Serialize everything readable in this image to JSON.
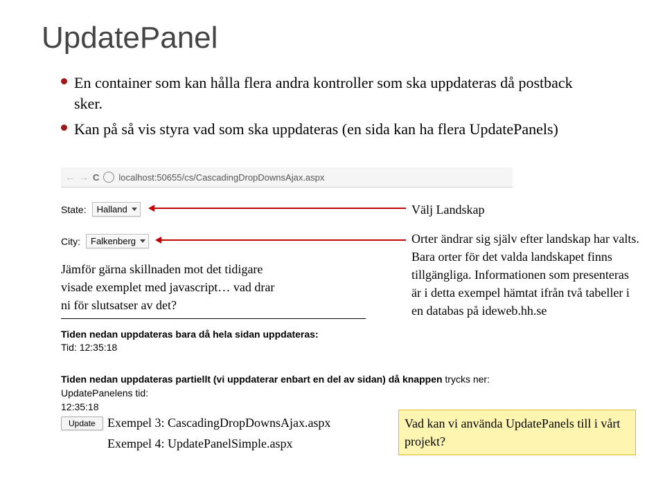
{
  "title": "UpdatePanel",
  "bullet1": "En container som kan hålla flera andra kontroller som ska uppdateras då postback sker.",
  "bullet2": "Kan på så vis styra vad som ska uppdateras (en sida kan ha flera UpdatePanels)",
  "url": "localhost:50655/cs/CascadingDropDownsAjax.aspx",
  "stateLabel": "State:",
  "stateValue": "Halland",
  "cityLabel": "City:",
  "cityValue": "Falkenberg",
  "leftNote": "Jämför gärna skillnaden mot det tidigare visade exemplet med javascript… vad drar ni för slutsatser av det?",
  "rightHeading": "Välj Landskap",
  "rightNote": "Orter ändrar sig själv efter landskap har valts. Bara orter för det valda landskapet finns tillgängliga. Informationen som presenteras är i detta exempel hämtat ifrån två tabeller i en databas på ideweb.hh.se",
  "tidenLine1": "Tiden nedan uppdateras bara då hela sidan uppdateras:",
  "tidLabel": "Tid: 12:35:18",
  "tidenLine2a": "Tiden nedan uppdateras partiellt (vi uppdaterar enbart en del av sidan) då knappen",
  "tidenLine2b": " trycks ner:",
  "updatePanelensTid": "UpdatePanelens tid:",
  "time2": "12:35:18",
  "updateBtn": "Update",
  "exempel3": "Exempel 3: CascadingDropDownsAjax.aspx",
  "exempel4": "Exempel 4: UpdatePanelSimple.aspx",
  "highlightText": "Vad kan vi använda UpdatePanels till i vårt projekt?"
}
